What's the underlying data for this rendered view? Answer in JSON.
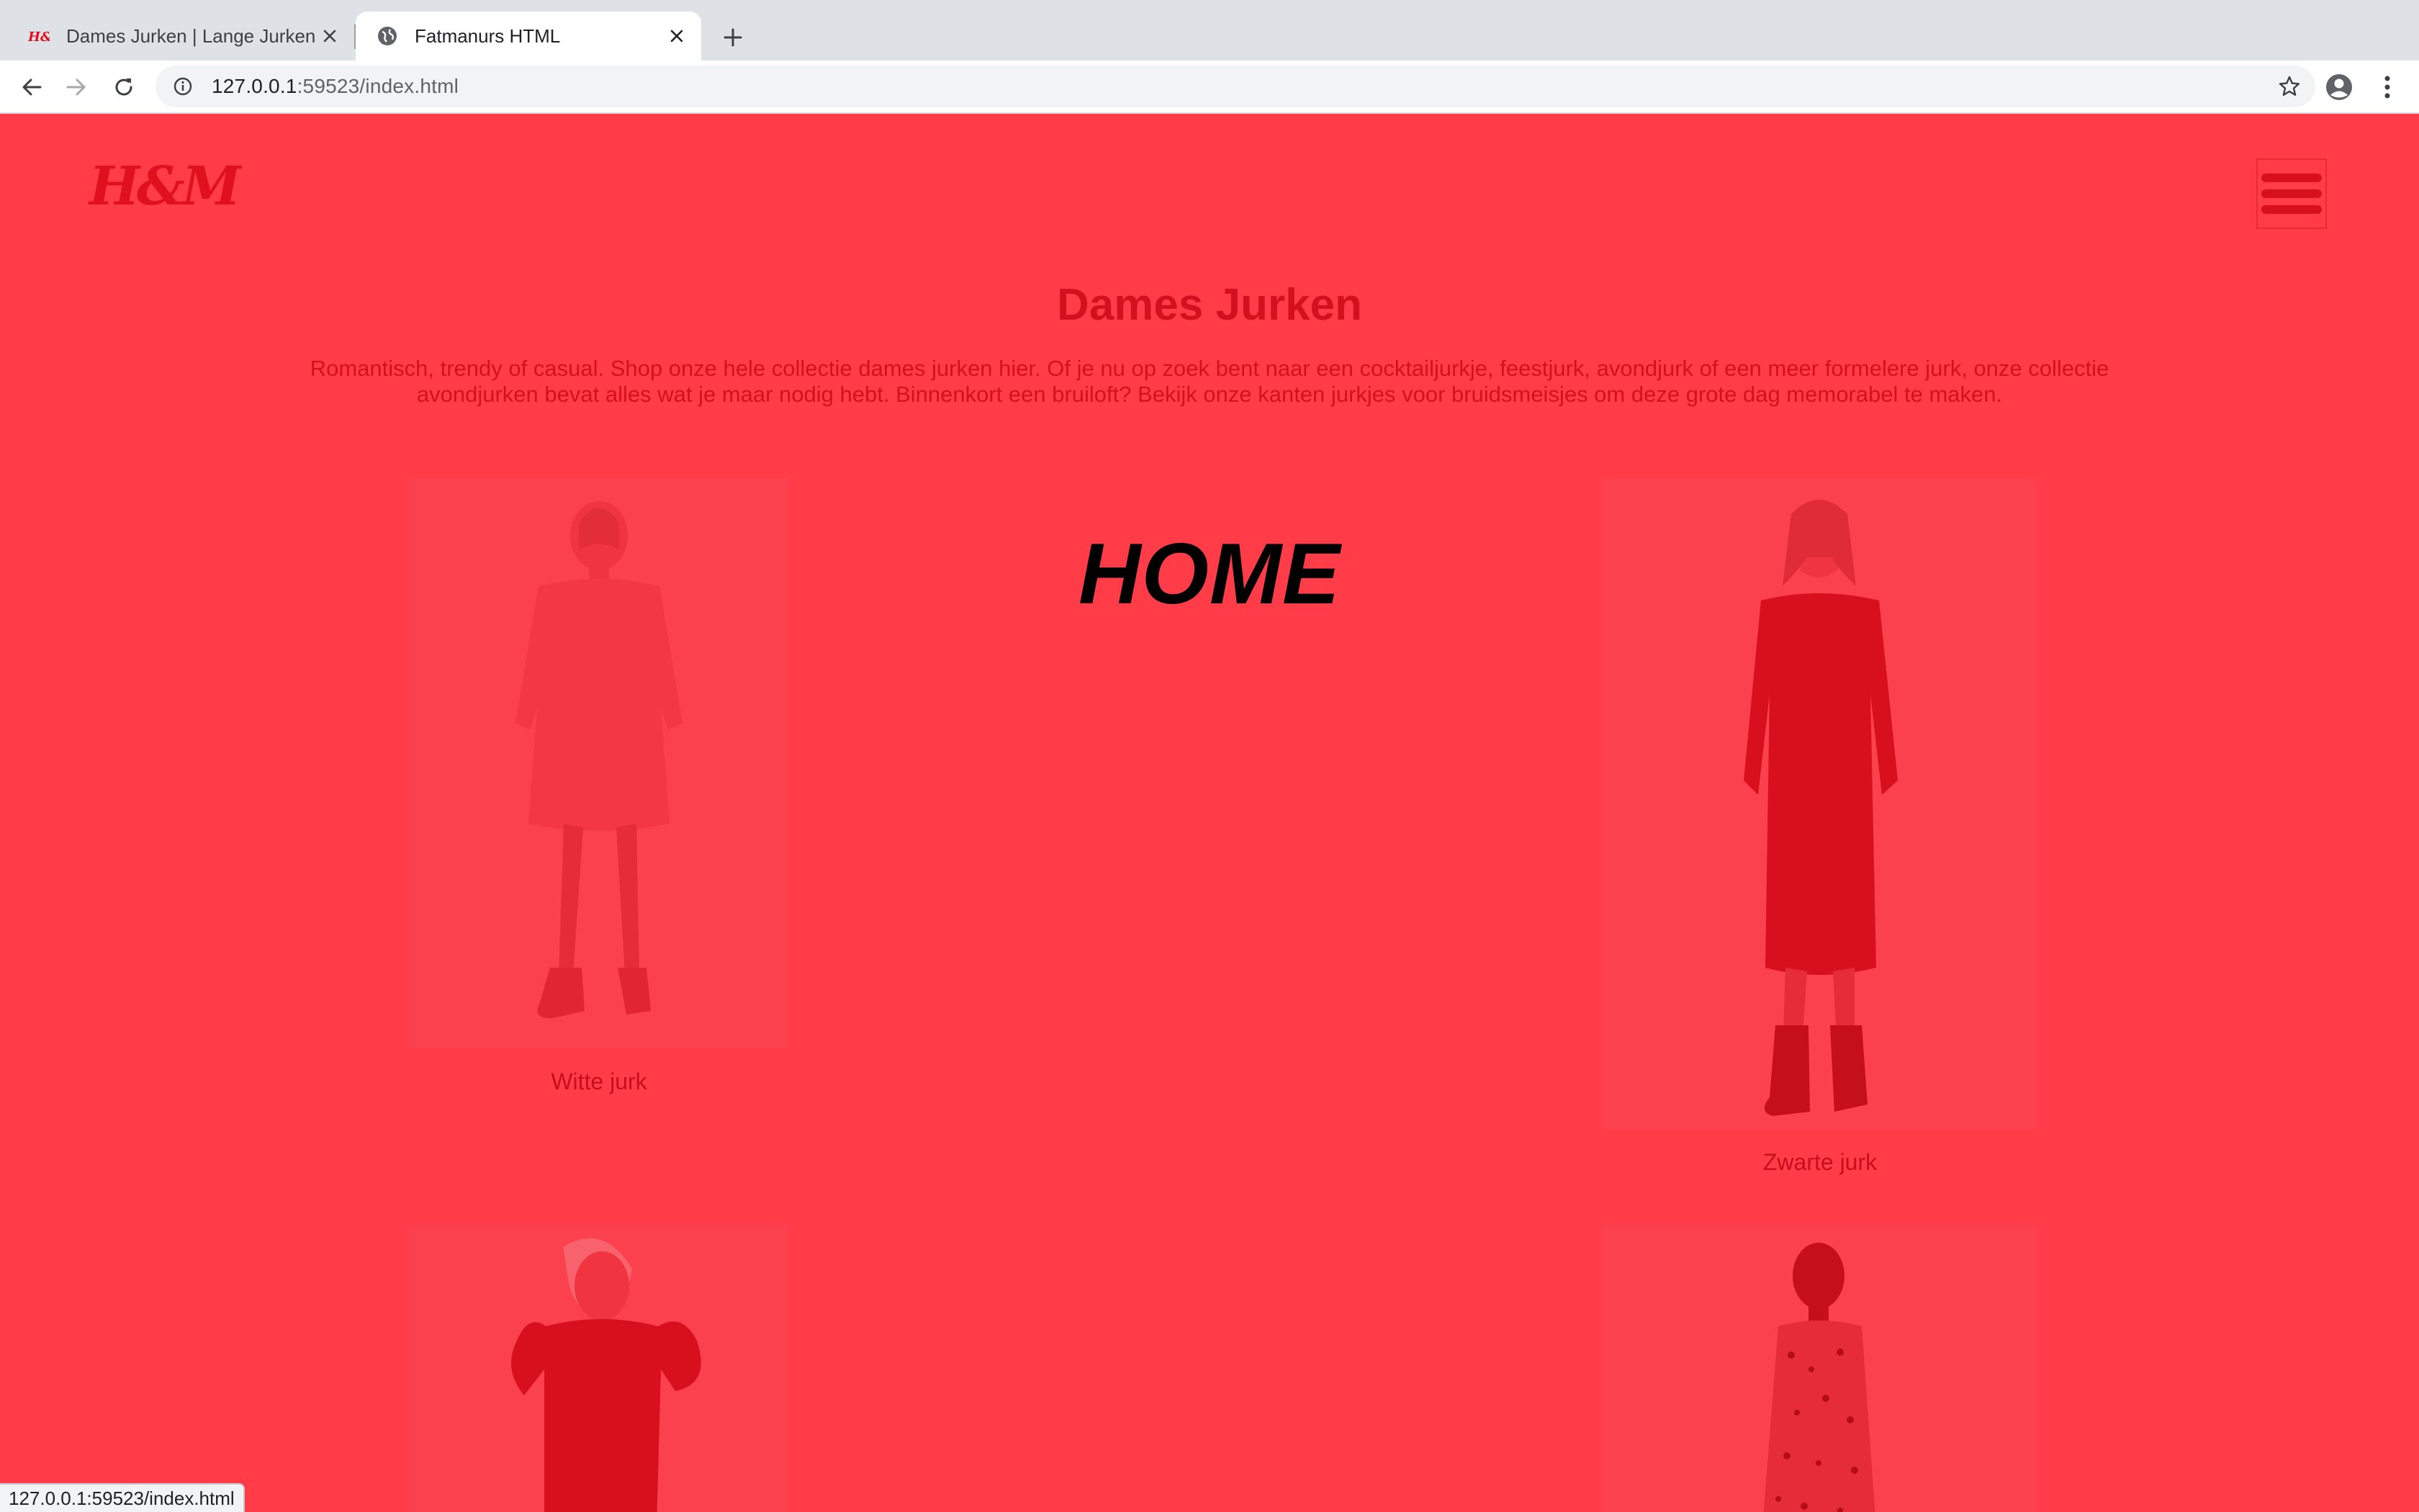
{
  "browser": {
    "tabs": [
      {
        "title": "Dames Jurken | Lange Jurken,",
        "favicon": "hm-favicon-icon",
        "active": false
      },
      {
        "title": "Fatmanurs HTML",
        "favicon": "globe-icon",
        "active": true
      }
    ],
    "url_host": "127.0.0.1",
    "url_path": ":59523/index.html",
    "status_url": "127.0.0.1:59523/index.html"
  },
  "page": {
    "logo": "H&M",
    "title": "Dames Jurken",
    "intro": "Romantisch, trendy of casual. Shop onze hele collectie dames jurken hier. Of je nu op zoek bent naar een cocktailjurkje, feestjurk, avondjurk of een meer formelere jurk, onze collectie avondjurken bevat alles wat je maar nodig hebt. Binnenkort een bruiloft? Bekijk onze kanten jurkjes voor bruidsmeisjes om deze grote dag memorabel te maken.",
    "overlay_text": "HOME",
    "products": [
      {
        "name": "Witte jurk"
      },
      {
        "name": "Zwarte jurk"
      },
      {
        "name": ""
      },
      {
        "name": ""
      }
    ]
  },
  "colors": {
    "overlay": "#ff3c48",
    "brand_red": "#e1101e",
    "chrome_bg": "#dee1e6"
  }
}
